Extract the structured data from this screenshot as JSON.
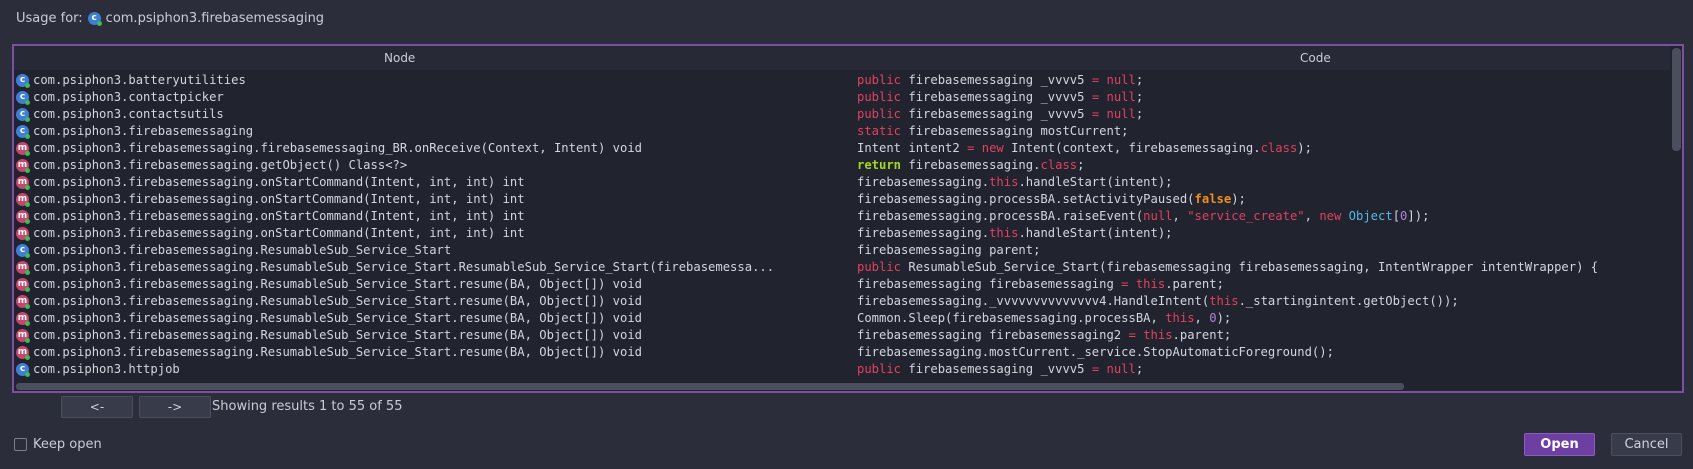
{
  "dialog": {
    "title_prefix": "Usage for:",
    "title_target": "com.psiphon3.firebasemessaging",
    "title_icon": "class-icon"
  },
  "columns": {
    "node": "Node",
    "code": "Code"
  },
  "rows": [
    {
      "icon": "c",
      "node": "com.psiphon3.batteryutilities",
      "code": [
        [
          "kw",
          "public"
        ],
        [
          "",
          "firebasemessaging _vvvv5 "
        ],
        [
          "kw",
          "="
        ],
        [
          "",
          " "
        ],
        [
          "kw",
          "null"
        ],
        [
          "",
          ";"
        ]
      ]
    },
    {
      "icon": "c",
      "node": "com.psiphon3.contactpicker",
      "code": [
        [
          "kw",
          "public"
        ],
        [
          "",
          "firebasemessaging _vvvv5 "
        ],
        [
          "kw",
          "="
        ],
        [
          "",
          " "
        ],
        [
          "kw",
          "null"
        ],
        [
          "",
          ";"
        ]
      ]
    },
    {
      "icon": "c",
      "node": "com.psiphon3.contactsutils",
      "code": [
        [
          "kw",
          "public"
        ],
        [
          "",
          "firebasemessaging _vvvv5 "
        ],
        [
          "kw",
          "="
        ],
        [
          "",
          " "
        ],
        [
          "kw",
          "null"
        ],
        [
          "",
          ";"
        ]
      ]
    },
    {
      "icon": "c",
      "node": "com.psiphon3.firebasemessaging",
      "code": [
        [
          "kw",
          "static"
        ],
        [
          "",
          "firebasemessaging mostCurrent;"
        ]
      ]
    },
    {
      "icon": "m",
      "node": "com.psiphon3.firebasemessaging.firebasemessaging_BR.onReceive(Context, Intent) void",
      "code": [
        [
          "",
          "Intent intent2 "
        ],
        [
          "kw",
          "="
        ],
        [
          "",
          " "
        ],
        [
          "kw",
          "new"
        ],
        [
          "",
          "Intent(context, firebasemessaging."
        ],
        [
          "kw",
          "class"
        ],
        [
          "",
          ");"
        ]
      ]
    },
    {
      "icon": "m",
      "node": "com.psiphon3.firebasemessaging.getObject() Class<?>",
      "code": [
        [
          "kw2",
          "return"
        ],
        [
          "",
          "firebasemessaging."
        ],
        [
          "kw",
          "class"
        ],
        [
          "",
          ";"
        ]
      ]
    },
    {
      "icon": "m",
      "node": "com.psiphon3.firebasemessaging.onStartCommand(Intent, int, int) int",
      "code": [
        [
          "",
          "firebasemessaging."
        ],
        [
          "kw",
          "this"
        ],
        [
          "",
          ".handleStart(intent);"
        ]
      ]
    },
    {
      "icon": "m",
      "node": "com.psiphon3.firebasemessaging.onStartCommand(Intent, int, int) int",
      "code": [
        [
          "",
          "firebasemessaging.processBA.setActivityPaused("
        ],
        [
          "bool",
          "false"
        ],
        [
          "",
          ");"
        ]
      ]
    },
    {
      "icon": "m",
      "node": "com.psiphon3.firebasemessaging.onStartCommand(Intent, int, int) int",
      "code": [
        [
          "",
          "firebasemessaging.processBA.raiseEvent("
        ],
        [
          "kw",
          "null"
        ],
        [
          "",
          ", "
        ],
        [
          "str",
          "\"service_create\""
        ],
        [
          "",
          ", "
        ],
        [
          "kw",
          "new"
        ],
        [
          "",
          ""
        ],
        [
          "cls",
          "Object"
        ],
        [
          "",
          "["
        ],
        [
          "num",
          "0"
        ],
        [
          "",
          "]);"
        ]
      ]
    },
    {
      "icon": "m",
      "node": "com.psiphon3.firebasemessaging.onStartCommand(Intent, int, int) int",
      "code": [
        [
          "",
          "firebasemessaging."
        ],
        [
          "kw",
          "this"
        ],
        [
          "",
          ".handleStart(intent);"
        ]
      ]
    },
    {
      "icon": "c",
      "node": "com.psiphon3.firebasemessaging.ResumableSub_Service_Start",
      "code": [
        [
          "",
          "firebasemessaging parent;"
        ]
      ]
    },
    {
      "icon": "m",
      "node": "com.psiphon3.firebasemessaging.ResumableSub_Service_Start.ResumableSub_Service_Start(firebasemessa...",
      "code": [
        [
          "kw",
          "public"
        ],
        [
          "",
          "ResumableSub_Service_Start(firebasemessaging firebasemessaging, IntentWrapper intentWrapper) {"
        ]
      ]
    },
    {
      "icon": "m",
      "node": "com.psiphon3.firebasemessaging.ResumableSub_Service_Start.resume(BA, Object[]) void",
      "code": [
        [
          "",
          "firebasemessaging firebasemessaging "
        ],
        [
          "kw",
          "="
        ],
        [
          "",
          " "
        ],
        [
          "kw",
          "this"
        ],
        [
          "",
          ".parent;"
        ]
      ]
    },
    {
      "icon": "m",
      "node": "com.psiphon3.firebasemessaging.ResumableSub_Service_Start.resume(BA, Object[]) void",
      "code": [
        [
          "",
          "firebasemessaging._vvvvvvvvvvvvvv4.HandleIntent("
        ],
        [
          "kw",
          "this"
        ],
        [
          "",
          "._startingintent.getObject());"
        ]
      ]
    },
    {
      "icon": "m",
      "node": "com.psiphon3.firebasemessaging.ResumableSub_Service_Start.resume(BA, Object[]) void",
      "code": [
        [
          "",
          "Common.Sleep(firebasemessaging.processBA, "
        ],
        [
          "kw",
          "this"
        ],
        [
          "",
          ", "
        ],
        [
          "num",
          "0"
        ],
        [
          "",
          ");"
        ]
      ]
    },
    {
      "icon": "m",
      "node": "com.psiphon3.firebasemessaging.ResumableSub_Service_Start.resume(BA, Object[]) void",
      "code": [
        [
          "",
          "firebasemessaging firebasemessaging2 "
        ],
        [
          "kw",
          "="
        ],
        [
          "",
          " "
        ],
        [
          "kw",
          "this"
        ],
        [
          "",
          ".parent;"
        ]
      ]
    },
    {
      "icon": "m",
      "node": "com.psiphon3.firebasemessaging.ResumableSub_Service_Start.resume(BA, Object[]) void",
      "code": [
        [
          "",
          "firebasemessaging.mostCurrent._service.StopAutomaticForeground();"
        ]
      ]
    },
    {
      "icon": "c",
      "node": "com.psiphon3.httpjob",
      "code": [
        [
          "kw",
          "public"
        ],
        [
          "",
          "firebasemessaging _vvvv5 "
        ],
        [
          "kw",
          "="
        ],
        [
          "",
          " "
        ],
        [
          "kw",
          "null"
        ],
        [
          "",
          ";"
        ]
      ]
    }
  ],
  "pager": {
    "prev_label": "<-",
    "next_label": "->",
    "results_text": "Showing results 1 to 55 of 55"
  },
  "footer": {
    "keep_open_label": "Keep open",
    "open_label": "Open",
    "cancel_label": "Cancel"
  },
  "colors": {
    "accent": "#6d3fa3",
    "keyword": "#e0415f",
    "return_kw": "#a4d61e",
    "boolean": "#f28f1a",
    "number": "#b283e0",
    "type": "#55b8e8",
    "class_icon": "#3e7fd6",
    "method_icon": "#c5476b"
  }
}
